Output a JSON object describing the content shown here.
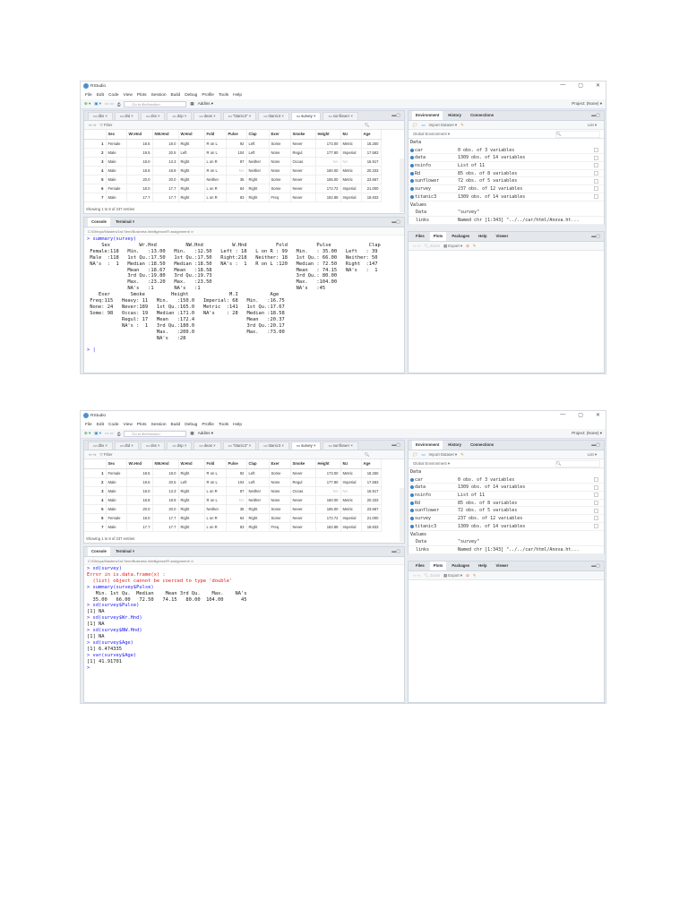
{
  "app": {
    "title": "RStudio",
    "window_controls": [
      "—",
      "▢",
      "✕"
    ],
    "menu": [
      "File",
      "Edit",
      "Code",
      "View",
      "Plots",
      "Session",
      "Build",
      "Debug",
      "Profile",
      "Tools",
      "Help"
    ],
    "goto_placeholder": "Go to file/function",
    "addins": "Addins ▾",
    "project": "Project: (None) ▾"
  },
  "source": {
    "tabs": [
      "dbs",
      "dtd",
      "dss",
      "dsp",
      "deas",
      "\"titanic3\"",
      "titanic3",
      "survey",
      "sunflower"
    ],
    "active_tab": "survey",
    "filter_label": "Filter",
    "columns": [
      "",
      "Sex",
      "Wr.Hnd",
      "NW.Hnd",
      "W.Hnd",
      "Fold",
      "Pulse",
      "Clap",
      "Exer",
      "Smoke",
      "Height",
      "M.I",
      "Age"
    ],
    "rows": [
      [
        "1",
        "Female",
        "18.5",
        "18.0",
        "Right",
        "R on L",
        "92",
        "Left",
        "Some",
        "Never",
        "173.00",
        "Metric",
        "18.250"
      ],
      [
        "2",
        "Male",
        "19.5",
        "20.5",
        "Left",
        "R on L",
        "104",
        "Left",
        "None",
        "Regul",
        "177.80",
        "Imperial",
        "17.583"
      ],
      [
        "3",
        "Male",
        "18.0",
        "13.3",
        "Right",
        "L on R",
        "87",
        "Neither",
        "None",
        "Occas",
        "NA",
        "NA",
        "16.917"
      ],
      [
        "4",
        "Male",
        "18.8",
        "18.9",
        "Right",
        "R on L",
        "NA",
        "Neither",
        "None",
        "Never",
        "160.00",
        "Metric",
        "20.333"
      ],
      [
        "5",
        "Male",
        "20.0",
        "20.0",
        "Right",
        "Neither",
        "35",
        "Right",
        "Some",
        "Never",
        "165.00",
        "Metric",
        "23.667"
      ],
      [
        "6",
        "Female",
        "18.0",
        "17.7",
        "Right",
        "L on R",
        "64",
        "Right",
        "Some",
        "Never",
        "172.72",
        "Imperial",
        "21.000"
      ],
      [
        "7",
        "Male",
        "17.7",
        "17.7",
        "Right",
        "L on R",
        "83",
        "Right",
        "Freq",
        "Never",
        "182.88",
        "Imperial",
        "18.833"
      ]
    ],
    "status": "Showing 1 to 8 of 237 entries"
  },
  "console": {
    "tabs": [
      "Console",
      "Terminal ×"
    ],
    "path": "C:/Dhivya/Masters/1st Sem/Business Intelligence/R assignment/"
  },
  "environment": {
    "tabs": [
      "Environment",
      "History",
      "Connections"
    ],
    "import_label": "Import Dataset ▾",
    "list_label": "List ▾",
    "scope": "Global Environment ▾",
    "data_header": "Data",
    "data": [
      {
        "name": "car",
        "value": "0 obs. of 3 variables"
      },
      {
        "name": "data",
        "value": "1309 obs. of 14 variables"
      },
      {
        "name": "nsinfo",
        "value": "List of 11"
      },
      {
        "name": "Rd",
        "value": "85 obs. of 8 variables"
      },
      {
        "name": "sunflower",
        "value": "72 obs. of 5 variables"
      },
      {
        "name": "survey",
        "value": "237 obs. of 12 variables"
      },
      {
        "name": "titanic3",
        "value": "1309 obs. of 14 variables"
      }
    ],
    "values_header": "Values",
    "values": [
      {
        "name": "Data",
        "value": "\"survey\""
      },
      {
        "name": "links",
        "value": "Named chr [1:343] \"../../car/html/Anova.ht..."
      }
    ]
  },
  "files": {
    "tabs": [
      "Files",
      "Plots",
      "Packages",
      "Help",
      "Viewer"
    ],
    "zoom": "Zoom",
    "export": "Export ▾"
  },
  "screenshots": [
    {
      "console_lines": [
        {
          "k": "cmd",
          "t": "> summary(survey)"
        },
        {
          "k": "out",
          "t": "     Sex          Wr.Hnd          NW.Hnd          W.Hnd          Fold          Pulse             Clap"
        },
        {
          "k": "out",
          "t": " Female:118   Min.   :13.00   Min.   :12.50   Left : 18   L on R : 99   Min.   : 35.00   Left   : 39"
        },
        {
          "k": "out",
          "t": " Male  :118   1st Qu.:17.50   1st Qu.:17.50   Right:218   Neither: 18   1st Qu.: 66.00   Neither: 50"
        },
        {
          "k": "out",
          "t": " NA's  :  1   Median :18.50   Median :18.50   NA's :  1   R on L :120   Median : 72.50   Right  :147"
        },
        {
          "k": "out",
          "t": "              Mean   :18.67   Mean   :18.58                             Mean   : 74.15   NA's   :  1"
        },
        {
          "k": "out",
          "t": "              3rd Qu.:19.80   3rd Qu.:19.73                             3rd Qu.: 80.00"
        },
        {
          "k": "out",
          "t": "              Max.   :23.20   Max.   :23.50                             Max.   :104.00"
        },
        {
          "k": "out",
          "t": "              NA's   :1       NA's   :1                                 NA's   :45"
        },
        {
          "k": "out",
          "t": "    Exer       Smoke         Height              M.I           Age"
        },
        {
          "k": "out",
          "t": " Freq:115   Heavy: 11   Min.   :150.0   Imperial: 68   Min.   :16.75"
        },
        {
          "k": "out",
          "t": " None: 24   Never:189   1st Qu.:165.0   Metric  :141   1st Qu.:17.67"
        },
        {
          "k": "out",
          "t": " Some: 98   Occas: 19   Median :171.0   NA's    : 28   Median :18.58"
        },
        {
          "k": "out",
          "t": "            Regul: 17   Mean   :172.4                  Mean   :20.37"
        },
        {
          "k": "out",
          "t": "            NA's :  1   3rd Qu.:180.0                  3rd Qu.:20.17"
        },
        {
          "k": "out",
          "t": "                        Max.   :200.0                  Max.   :73.00"
        },
        {
          "k": "out",
          "t": "                        NA's   :28"
        },
        {
          "k": "out",
          "t": " "
        },
        {
          "k": "cmd",
          "t": "> |"
        }
      ]
    },
    {
      "console_lines": [
        {
          "k": "cmd",
          "t": "> sd(survey)"
        },
        {
          "k": "err",
          "t": "Error in is.data.frame(x) :"
        },
        {
          "k": "err",
          "t": "  (list) object cannot be coerced to type 'double'"
        },
        {
          "k": "cmd",
          "t": "> summary(survey$Pulse)"
        },
        {
          "k": "out",
          "t": "   Min. 1st Qu.  Median    Mean 3rd Qu.    Max.    NA's"
        },
        {
          "k": "out",
          "t": "  35.00   66.00   72.50   74.15   80.00  104.00      45"
        },
        {
          "k": "cmd",
          "t": "> sd(survey$Pulse)"
        },
        {
          "k": "out",
          "t": "[1] NA"
        },
        {
          "k": "cmd",
          "t": "> sd(survey$Wr.Hnd)"
        },
        {
          "k": "out",
          "t": "[1] NA"
        },
        {
          "k": "cmd",
          "t": "> sd(survey$NW.Hnd)"
        },
        {
          "k": "out",
          "t": "[1] NA"
        },
        {
          "k": "cmd",
          "t": "> sd(survey$Age)"
        },
        {
          "k": "out",
          "t": "[1] 6.474335"
        },
        {
          "k": "cmd",
          "t": "> var(survey$Age)"
        },
        {
          "k": "out",
          "t": "[1] 41.91701"
        },
        {
          "k": "cmd",
          "t": ">"
        }
      ]
    }
  ]
}
